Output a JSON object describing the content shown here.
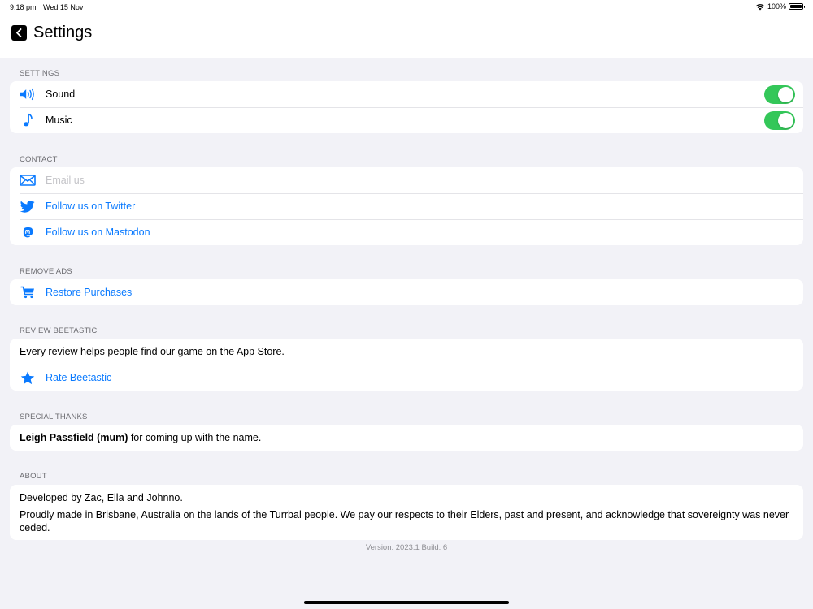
{
  "status_bar": {
    "time": "9:18 pm",
    "date": "Wed 15 Nov",
    "battery": "100%",
    "icons": [
      "wifi-icon",
      "battery-icon"
    ]
  },
  "nav": {
    "title": "Settings",
    "back_icon": "chevron-left-icon"
  },
  "sections": {
    "settings": {
      "header": "SETTINGS",
      "sound_label": "Sound",
      "sound_on": true,
      "music_label": "Music",
      "music_on": true
    },
    "contact": {
      "header": "CONTACT",
      "email_label": "Email us",
      "twitter_label": "Follow us on Twitter",
      "mastodon_label": "Follow us on Mastodon"
    },
    "remove_ads": {
      "header": "REMOVE ADS",
      "restore_label": "Restore Purchases"
    },
    "review": {
      "header": "REVIEW BEETASTIC",
      "description": "Every review helps people find our game on the App Store.",
      "rate_label": "Rate Beetastic"
    },
    "thanks": {
      "header": "SPECIAL THANKS",
      "name": "Leigh Passfield (mum)",
      "reason": " for coming up with the name."
    },
    "about": {
      "header": "ABOUT",
      "line1": "Developed by Zac, Ella and Johnno.",
      "line2": "Proudly made in Brisbane, Australia on the lands of the Turrbal people. We pay our respects to their Elders, past and present, and acknowledge that sovereignty was never ceded."
    }
  },
  "version": "Version: 2023.1 Build: 6",
  "colors": {
    "accent": "#0a7aff",
    "toggle_on": "#34c759",
    "background": "#f2f2f7",
    "section_text": "#6d6d72"
  }
}
